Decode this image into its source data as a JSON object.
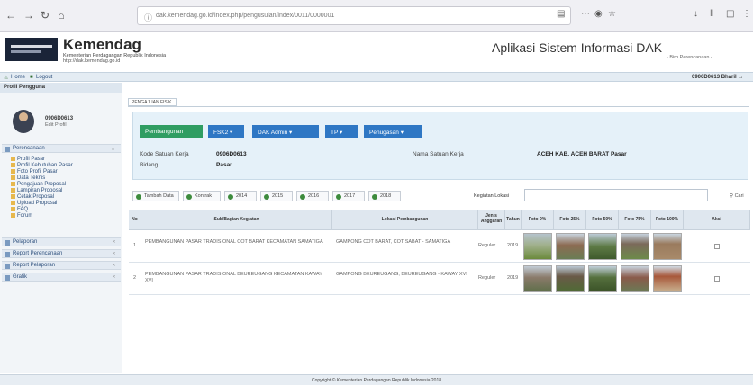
{
  "browser": {
    "url": "dak.kemendag.go.id/index.php/pengusulan/index/0011/0000001"
  },
  "header": {
    "brand": "Kemendag",
    "subtitle": "Kementerian Perdagangan Republik Indonesia",
    "url": "http://dak.kemendag.go.id",
    "app_title": "Aplikasi Sistem Informasi DAK",
    "app_subtitle": "- Biro Perencanaan -"
  },
  "topnav": {
    "home": "Home",
    "logout": "Logout",
    "user_right": "0906D0613 Bharil →"
  },
  "sidebar": {
    "title": "Profil Pengguna",
    "user_id": "0906D0613",
    "user_link": "Edit Profil",
    "sections": [
      "Perencanaan",
      "Pelaporan",
      "Report Perencanaan",
      "Report Pelaporan",
      "Grafik"
    ],
    "items": [
      "Profil Pasar",
      "Profil Kebutuhan Pasar",
      "Foto Profil Pasar",
      "Data Teknis",
      "Pengajuan Proposal",
      "Lampiran Proposal",
      "Cetak Proposal",
      "Upload Proposal",
      "FAQ",
      "Forum"
    ]
  },
  "main": {
    "tab": "PENGAJUAN FISIK",
    "buttons": [
      "Pembangunan",
      "FSK2 ▾",
      "DAK Admin ▾",
      "TP ▾",
      "Penugasan ▾"
    ],
    "labels": {
      "kode": "Kode Satuan Kerja",
      "bidang": "Bidang",
      "nama": "Nama Satuan Kerja"
    },
    "values": {
      "kode": "0906D0613",
      "bidang": "Pasar",
      "nama": "ACEH KAB. ACEH BARAT Pasar"
    },
    "toolbar": [
      "Tambah Data",
      "Kontrak",
      "2014",
      "2015",
      "2016",
      "2017",
      "2018"
    ],
    "search_label": "Kegiatan Lokasi",
    "search_btn": "Cari"
  },
  "table": {
    "headers": [
      "No",
      "Sub/Bagian Kegiatan",
      "Lokasi Pembangunan",
      "Jenis Anggaran",
      "Tahun",
      "Foto 0%",
      "Foto 25%",
      "Foto 50%",
      "Foto 75%",
      "Foto 100%",
      "Aksi"
    ],
    "rows": [
      {
        "no": "1",
        "kegiatan": "PEMBANGUNAN PASAR TRADISIONAL COT BARAT KECAMATAN SAMATIGA",
        "lokasi": "GAMPONG COT BARAT, COT SABAT - SAMATIGA",
        "jenis": "Reguler",
        "tahun": "2019"
      },
      {
        "no": "2",
        "kegiatan": "PEMBANGUNAN PASAR TRADISIONAL BEUREUGANG KECAMATAN KAWAY XVI",
        "lokasi": "GAMPONG BEUREUGANG, BEUREUGANG - KAWAY XVI",
        "jenis": "Reguler",
        "tahun": "2019"
      }
    ]
  },
  "footer": "Copyright © Kementerian Perdagangan Republik Indonesia 2018",
  "colors": {
    "primary": "#2e77c4",
    "green": "#2f9d62",
    "panel": "#e5f1f9"
  }
}
